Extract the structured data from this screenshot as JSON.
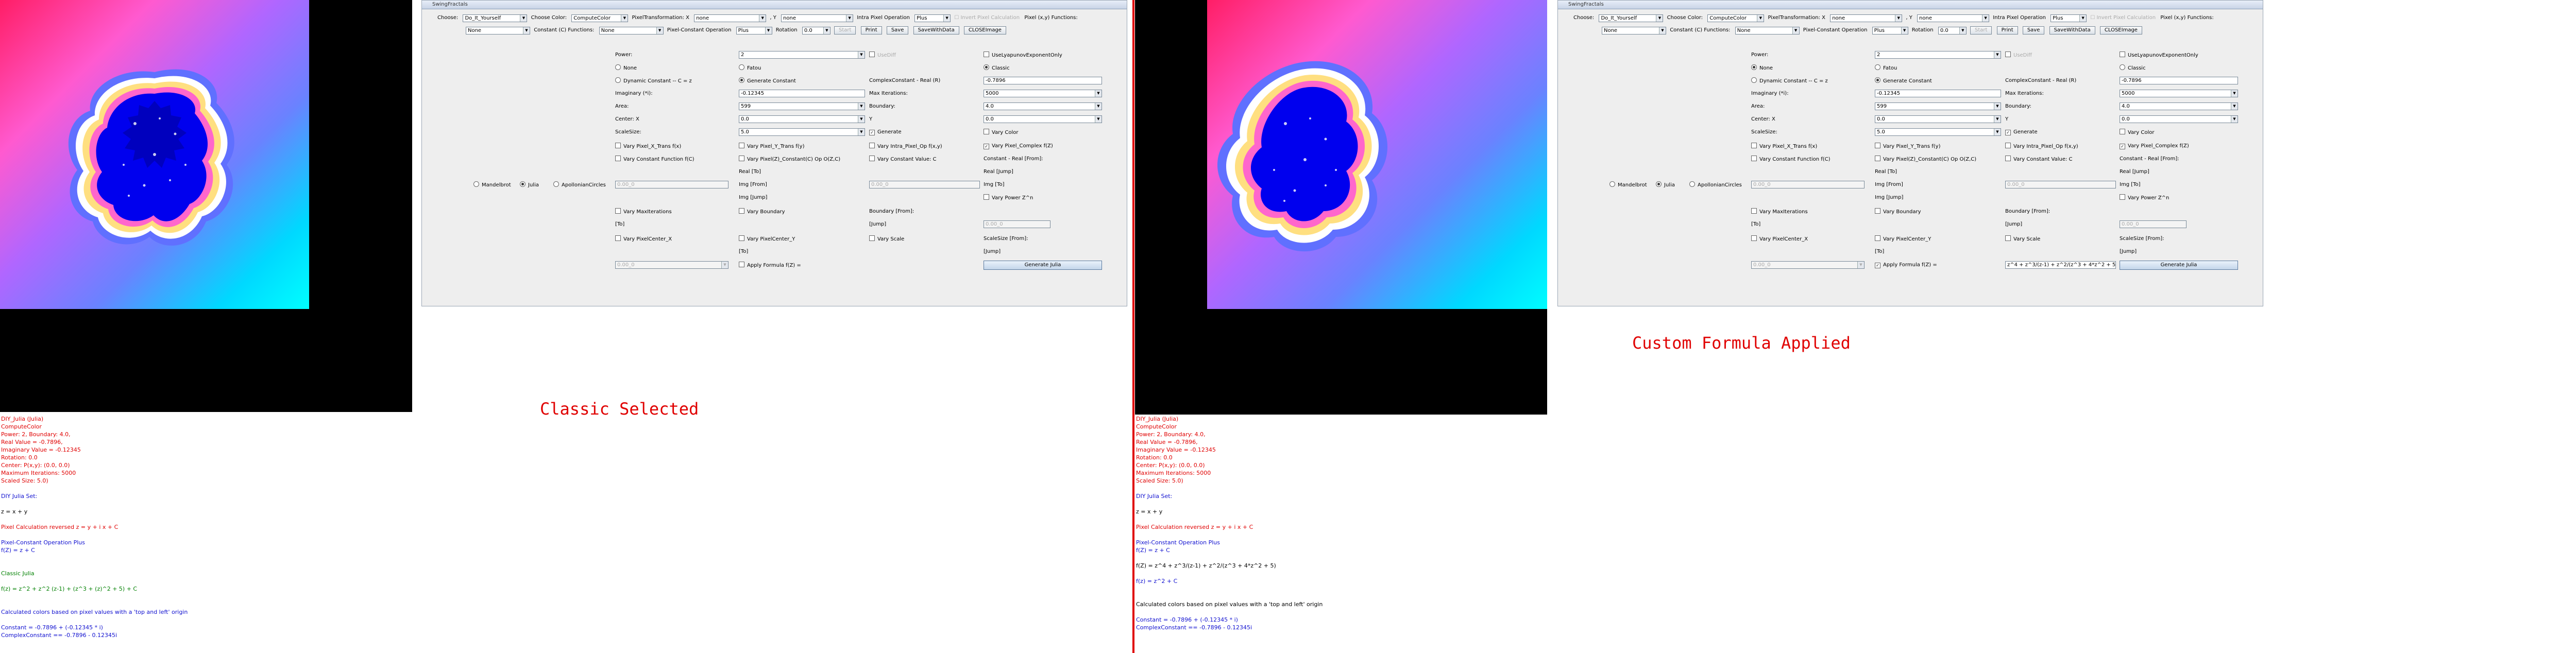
{
  "window": {
    "title": "SwingFractals",
    "toolbar": {
      "choose_label": "Choose:",
      "choose_value": "Do_It_Yourself",
      "choose_color_label": "Choose Color:",
      "choose_color_value": "ComputeColor",
      "pixel_transformation_label": "PixelTransformation: X",
      "pixel_transformation_x": "none",
      "pixel_transformation_y_label": ", Y",
      "pixel_transformation_y": "none",
      "intra_pixel_label": "Intra Pixel Operation",
      "intra_pixel_value": "Plus",
      "invert_pixel_label": "Invert Pixel Calculation",
      "pixel_functions_label": "Pixel (x,y) Functions:",
      "pixel_functions_value": "None",
      "constant_functions_label": "Constant (C) Functions:",
      "constant_functions_value": "None",
      "pixel_constant_op_label": "Pixel-Constant Operation",
      "pixel_constant_op_value": "Plus",
      "rotation_label": "Rotation",
      "rotation_value": "0.0",
      "start_label": "Start",
      "print_label": "Print",
      "save_label": "Save",
      "save_with_data_label": "SaveWithData",
      "close_image_label": "CLOSEImage"
    },
    "form": {
      "power_label": "Power:",
      "power_value": "2",
      "use_diff_label": "UseDiff",
      "use_lyapunov_label": "UseLyapunovExponentOnly",
      "none_label": "None",
      "fatou_label": "Fatou",
      "classic_label": "Classic",
      "dynamic_constant_label": "Dynamic Constant -- C = z",
      "generate_constant_label": "Generate Constant",
      "z_squared_label": "Z Squared",
      "imaginary_label": "Imaginary (*i):",
      "imaginary_value": "-0.12345",
      "complex_real_label": "ComplexConstant - Real (R)",
      "complex_real_value": "-0.7896",
      "area_label": "Area:",
      "area_value": "599",
      "max_iterations_label": "Max Iterations:",
      "max_iterations_value": "5000",
      "boundary_label": "Boundary:",
      "boundary_value": "4.0",
      "center_x_label": "Center: X",
      "center_x_value": "0.0",
      "center_y_label": "Y",
      "center_y_value": "0.0",
      "scale_size_label": "ScaleSize:",
      "scale_size_value": "5.0",
      "vary_color_label": "Vary Color",
      "generate_label": "Generate",
      "vary_pixel_x_trans_label": "Vary Pixel_X_Trans f(x)",
      "vary_pixel_y_trans_label": "Vary Pixel_Y_Trans f(y)",
      "vary_intra_pixel_label": "Vary Intra_Pixel_Op f(x,y)",
      "vary_pixel_complex_label": "Vary Pixel_Complex f(Z)",
      "vary_constant_function_label": "Vary Constant Function f(C)",
      "vary_pixel_constant_op_label": "Vary Pixel(Z)_Constant(C) Op O(Z,C)",
      "vary_constant_value_label": "Vary Constant Value: C",
      "constant_real_from_label": "Constant - Real [From]:",
      "real_to_label": "Real [To]",
      "real_jump_label": "Real [Jump]",
      "img_from_label": "Img [From]",
      "img_to_label": "Img [To]",
      "img_jump_label": "Img [Jump]",
      "placeholder_value": "0.00_0",
      "vary_power_label": "Vary Power Z^n",
      "vary_max_iterations_label": "Vary MaxIterations",
      "vary_boundary_label": "Vary Boundary",
      "to_label": "[To]",
      "boundary_from_label": "Boundary [From]:",
      "jump_label": "[Jump]",
      "vary_pixel_center_x_label": "Vary PixelCenter_X",
      "vary_pixel_center_y_label": "Vary PixelCenter_Y",
      "vary_scale_label": "Vary Scale",
      "scale_size_from_label": "ScaleSize [From]:",
      "apply_formula_label": "Apply Formula f(Z) =",
      "formula_value": "z^4 + z^3/(z-1) + z^2/(z^3 + 4*z^2 + 5)",
      "generate_julia_label": "Generate Julia",
      "mandelbrot_label": "Mandelbrot",
      "julia_label": "Julia",
      "apollonian_label": "ApollonianCircles"
    }
  },
  "captions": {
    "left": "Classic Selected",
    "right": "Custom Formula Applied"
  },
  "log_left": [
    {
      "t": "DIY_Julia (Julia)",
      "c": "red"
    },
    {
      "t": "ComputeColor",
      "c": "red"
    },
    {
      "t": "Power: 2, Boundary: 4.0,",
      "c": "red"
    },
    {
      "t": "Real Value = -0.7896,",
      "c": "red"
    },
    {
      "t": "Imaginary Value = -0.12345",
      "c": "red"
    },
    {
      "t": "Rotation: 0.0",
      "c": "red"
    },
    {
      "t": "Center: P(x,y): (0.0, 0.0)",
      "c": "red"
    },
    {
      "t": "Maximum Iterations: 5000",
      "c": "red"
    },
    {
      "t": "Scaled Size: 5.0)",
      "c": "red"
    },
    {
      "t": "",
      "c": "black"
    },
    {
      "t": "DIY Julia Set:",
      "c": "blue"
    },
    {
      "t": "",
      "c": "black"
    },
    {
      "t": "z = x + y",
      "c": "black"
    },
    {
      "t": "",
      "c": "black"
    },
    {
      "t": "Pixel Calculation reversed z = y + i x + C",
      "c": "red"
    },
    {
      "t": "",
      "c": "black"
    },
    {
      "t": "Pixel-Constant Operation Plus",
      "c": "blue"
    },
    {
      "t": "f(Z) = z + C",
      "c": "blue"
    },
    {
      "t": "",
      "c": "black"
    },
    {
      "t": "",
      "c": "black"
    },
    {
      "t": "Classic Julia",
      "c": "green"
    },
    {
      "t": "",
      "c": "black"
    },
    {
      "t": "f(z) = z^2 + z^2 (z-1) + (z^3 + (z)^2 + 5) + C",
      "c": "green"
    },
    {
      "t": "",
      "c": "black"
    },
    {
      "t": "",
      "c": "black"
    },
    {
      "t": "Calculated colors based on pixel values with a 'top and left' origin",
      "c": "blue"
    },
    {
      "t": "",
      "c": "black"
    },
    {
      "t": "Constant = -0.7896 + (-0.12345 * i)",
      "c": "blue"
    },
    {
      "t": "ComplexConstant == -0.7896 - 0.12345i",
      "c": "blue"
    }
  ],
  "log_right": [
    {
      "t": "DIY_Julia (Julia)",
      "c": "red"
    },
    {
      "t": "ComputeColor",
      "c": "red"
    },
    {
      "t": "Power: 2, Boundary: 4.0,",
      "c": "red"
    },
    {
      "t": "Real Value = -0.7896,",
      "c": "red"
    },
    {
      "t": "Imaginary Value = -0.12345",
      "c": "red"
    },
    {
      "t": "Rotation: 0.0",
      "c": "red"
    },
    {
      "t": "Center: P(x,y): (0.0, 0.0)",
      "c": "red"
    },
    {
      "t": "Maximum Iterations: 5000",
      "c": "red"
    },
    {
      "t": "Scaled Size: 5.0)",
      "c": "red"
    },
    {
      "t": "",
      "c": "black"
    },
    {
      "t": "DIY Julia Set:",
      "c": "blue"
    },
    {
      "t": "",
      "c": "black"
    },
    {
      "t": "z = x + y",
      "c": "black"
    },
    {
      "t": "",
      "c": "black"
    },
    {
      "t": "Pixel Calculation reversed z = y + i x + C",
      "c": "red"
    },
    {
      "t": "",
      "c": "black"
    },
    {
      "t": "Pixel-Constant Operation Plus",
      "c": "blue"
    },
    {
      "t": "f(Z) = z + C",
      "c": "blue"
    },
    {
      "t": "",
      "c": "black"
    },
    {
      "t": "f(Z) = z^4 + z^3/(z-1) + z^2/(z^3 + 4*z^2 + 5)",
      "c": "black"
    },
    {
      "t": "",
      "c": "black"
    },
    {
      "t": "f(z) = z^2 + C",
      "c": "blue"
    },
    {
      "t": "",
      "c": "black"
    },
    {
      "t": "",
      "c": "black"
    },
    {
      "t": "Calculated colors based on pixel values with a 'top and left' origin",
      "c": "black"
    },
    {
      "t": "",
      "c": "black"
    },
    {
      "t": "Constant = -0.7896 + (-0.12345 * i)",
      "c": "blue"
    },
    {
      "t": "ComplexConstant == -0.7896 - 0.12345i",
      "c": "blue"
    }
  ],
  "colors": {
    "accent_red": "#e00000",
    "log_blue": "#1010d0",
    "log_green": "#008000"
  }
}
